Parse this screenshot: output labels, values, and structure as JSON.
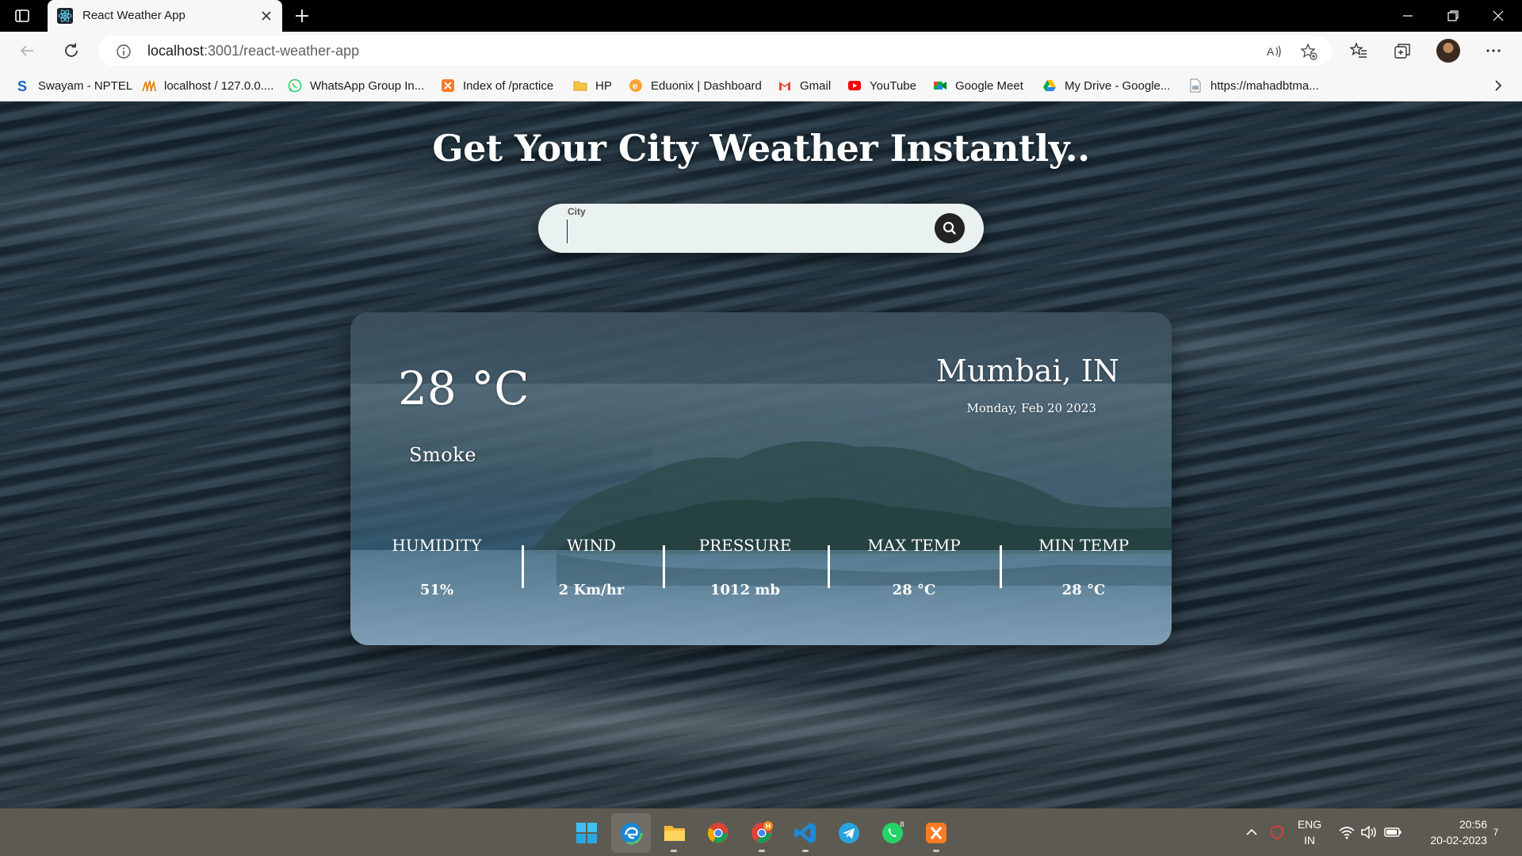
{
  "browser": {
    "tab_title": "React Weather App",
    "url_host": "localhost",
    "url_path": ":3001/react-weather-app",
    "bookmarks": [
      {
        "label": "Swayam - NPTEL",
        "icon": "swayam-icon"
      },
      {
        "label": "localhost / 127.0.0....",
        "icon": "phpmyadmin-icon"
      },
      {
        "label": "WhatsApp Group In...",
        "icon": "whatsapp-icon"
      },
      {
        "label": "Index of /practice",
        "icon": "xampp-icon"
      },
      {
        "label": "HP",
        "icon": "folder-icon"
      },
      {
        "label": "Eduonix | Dashboard",
        "icon": "eduonix-icon"
      },
      {
        "label": "Gmail",
        "icon": "gmail-icon"
      },
      {
        "label": "YouTube",
        "icon": "youtube-icon"
      },
      {
        "label": "Google Meet",
        "icon": "meet-icon"
      },
      {
        "label": "My Drive - Google...",
        "icon": "drive-icon"
      },
      {
        "label": "https://mahadbtma...",
        "icon": "page-icon"
      }
    ]
  },
  "app": {
    "heading": "Get Your City Weather Instantly..",
    "search": {
      "label": "City",
      "value": ""
    },
    "weather": {
      "temperature": "28 °C",
      "condition": "Smoke",
      "city": "Mumbai, IN",
      "date": "Monday, Feb 20 2023",
      "stats": [
        {
          "label": "HUMIDITY",
          "value": "51%"
        },
        {
          "label": "WIND",
          "value": "2 Km/hr"
        },
        {
          "label": "PRESSURE",
          "value": "1012 mb"
        },
        {
          "label": "MAX TEMP",
          "value": "28 °C"
        },
        {
          "label": "MIN TEMP",
          "value": "28 °C"
        }
      ]
    }
  },
  "taskbar": {
    "apps": [
      "windows-start-icon",
      "edge-icon",
      "file-explorer-icon",
      "chrome-icon",
      "chrome-profile-icon",
      "vscode-icon",
      "telegram-icon",
      "whatsapp-icon",
      "xampp-icon"
    ],
    "whatsapp_badge": "8",
    "chrome_profile_badge": "H",
    "language_top": "ENG",
    "language_bottom": "IN",
    "time": "20:56",
    "date": "20-02-2023",
    "notification_count": "7"
  }
}
